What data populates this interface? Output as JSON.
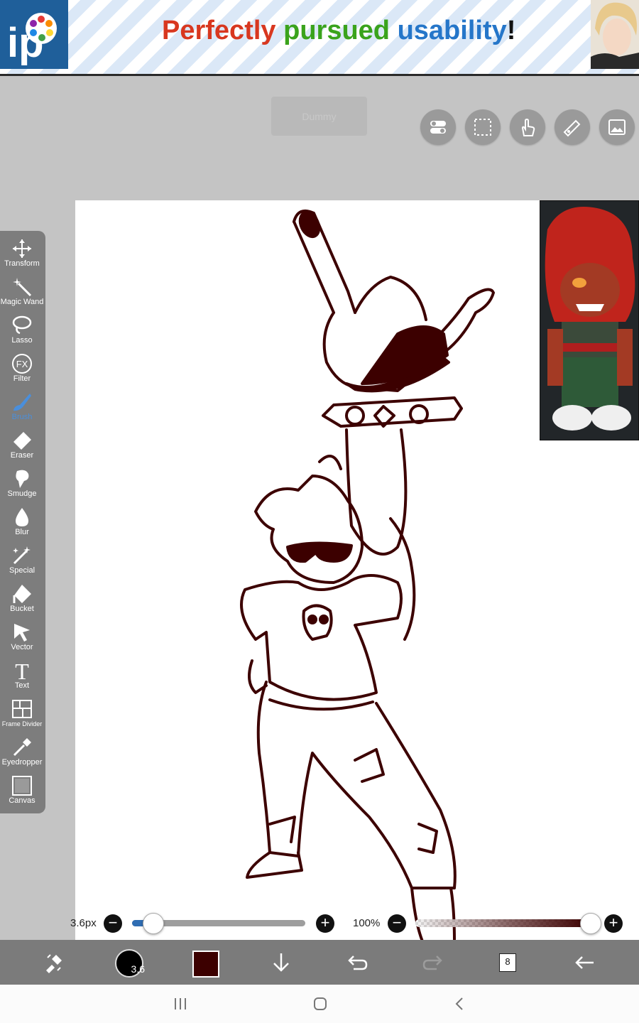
{
  "ad": {
    "word1": "Perfectly",
    "word2": "pursued",
    "word3": "usability",
    "punct": "!",
    "colors": {
      "word1": "#d8371f",
      "word2": "#3aa31c",
      "word3": "#2576c9"
    }
  },
  "top_buttons": {
    "dummy_label": "Dummy",
    "icons": [
      "toggle-icon",
      "selection-icon",
      "hand-icon",
      "ruler-icon",
      "image-icon"
    ]
  },
  "toolbar": {
    "tools": [
      {
        "label": "Transform",
        "icon": "move-icon"
      },
      {
        "label": "Magic Wand",
        "icon": "magic-wand-icon"
      },
      {
        "label": "Lasso",
        "icon": "lasso-icon"
      },
      {
        "label": "Filter",
        "icon": "fx-icon"
      },
      {
        "label": "Brush",
        "icon": "brush-icon",
        "active": true
      },
      {
        "label": "Eraser",
        "icon": "eraser-icon"
      },
      {
        "label": "Smudge",
        "icon": "smudge-icon"
      },
      {
        "label": "Blur",
        "icon": "drop-icon"
      },
      {
        "label": "Special",
        "icon": "special-icon"
      },
      {
        "label": "Bucket",
        "icon": "bucket-icon"
      },
      {
        "label": "Vector",
        "icon": "cursor-icon"
      },
      {
        "label": "Text",
        "icon": "text-icon"
      },
      {
        "label": "Frame Divider",
        "icon": "frame-icon"
      },
      {
        "label": "Eyedropper",
        "icon": "eyedropper-icon"
      },
      {
        "label": "Canvas",
        "icon": "canvas-icon"
      }
    ],
    "active_color": "#4a8fdc"
  },
  "sliders": {
    "size_label": "3.6px",
    "size_fraction": 0.12,
    "opacity_label": "100%",
    "opacity_fraction": 1.0,
    "minus": "−",
    "plus": "+"
  },
  "bottom_bar": {
    "brush_size": "3.6",
    "current_color": "#3c0000",
    "layer_count": "8"
  }
}
